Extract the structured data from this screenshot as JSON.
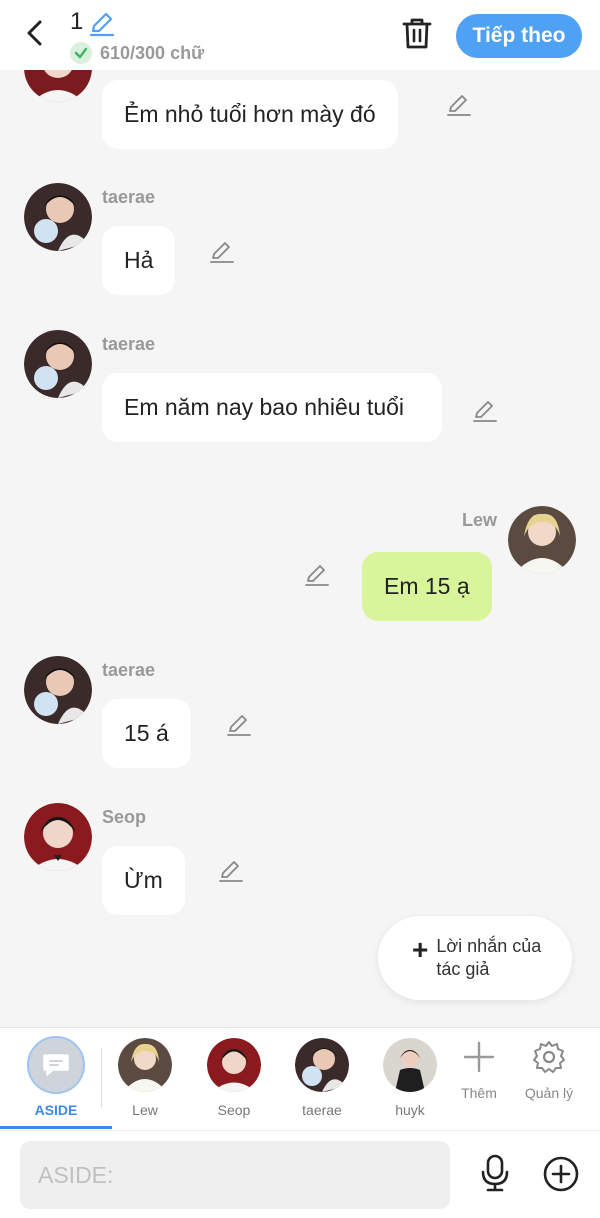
{
  "header": {
    "chapter_number": "1",
    "word_count": "610/300 chữ",
    "next_label": "Tiếp theo"
  },
  "messages": [
    {
      "sender": "",
      "text": "Ẻm nhỏ tuổi hơn mày đó",
      "mine": false
    },
    {
      "sender": "taerae",
      "text": "Hả",
      "mine": false
    },
    {
      "sender": "taerae",
      "text": "Em năm nay bao nhiêu tuổi",
      "mine": false
    },
    {
      "sender": "Lew",
      "text": "Em 15 ạ",
      "mine": true
    },
    {
      "sender": "taerae",
      "text": "15 á",
      "mine": false
    },
    {
      "sender": "Seop",
      "text": "Ừm",
      "mine": false
    }
  ],
  "author_note": {
    "label": "Lời nhắn của tác giả"
  },
  "characters": [
    {
      "name": "ASIDE",
      "active": true
    },
    {
      "name": "Lew"
    },
    {
      "name": "Seop"
    },
    {
      "name": "taerae"
    },
    {
      "name": "huyk"
    }
  ],
  "tools": {
    "add_label": "Thêm",
    "manage_label": "Quản lý"
  },
  "input": {
    "placeholder": "ASIDE:"
  },
  "colors": {
    "accent": "#4ea1f3",
    "my_bubble": "#d8f59b",
    "background": "#f5f5f5"
  }
}
